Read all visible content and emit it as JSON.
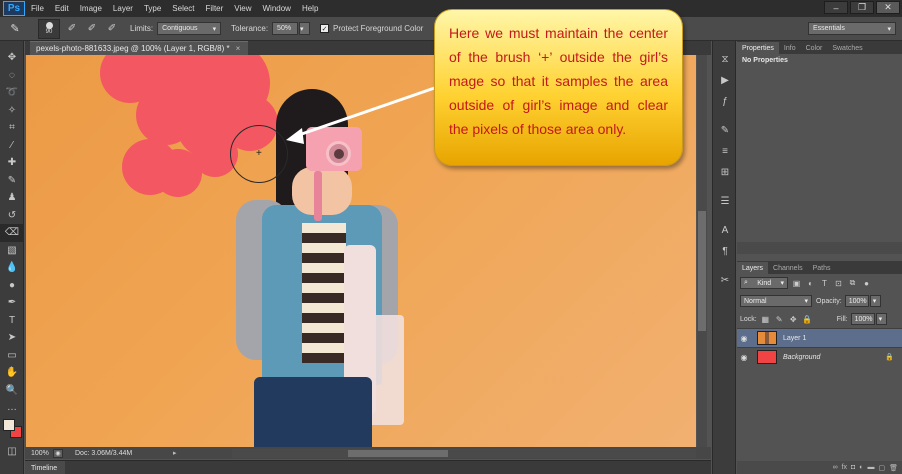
{
  "app": {
    "logo": "Ps"
  },
  "menu": [
    "File",
    "Edit",
    "Image",
    "Layer",
    "Type",
    "Select",
    "Filter",
    "View",
    "Window",
    "Help"
  ],
  "window_controls": {
    "minimize": "–",
    "restore": "❐",
    "close": "✕"
  },
  "options_bar": {
    "brush_size": "90",
    "limits_label": "Limits:",
    "limits_value": "Contiguous",
    "tolerance_label": "Tolerance:",
    "tolerance_value": "50%",
    "protect_label": "Protect Foreground Color",
    "protect_checked": "✓",
    "workspace": "Essentials"
  },
  "document": {
    "tab_title": "pexels-photo-881633.jpeg @ 100% (Layer 1, RGB/8) *",
    "tab_close": "×",
    "zoom": "100%",
    "doc_size": "Doc: 3.06M/3.44M",
    "status_arrow": "▸"
  },
  "timeline": {
    "tab": "Timeline"
  },
  "callout": {
    "text": "Here we must maintain the center of the brush ‘+’ outside the girl’s mage so that it samples the area outside of girl’s image and clear the pixels of those area only."
  },
  "brush_cursor": {
    "cross": "+"
  },
  "properties_panel": {
    "tabs": [
      "Properties",
      "Info",
      "Color",
      "Swatches"
    ],
    "body": "No Properties"
  },
  "layers_panel": {
    "tabs": [
      "Layers",
      "Channels",
      "Paths"
    ],
    "kind_label": "Kind",
    "blend_mode": "Normal",
    "opacity_label": "Opacity:",
    "opacity_value": "100%",
    "lock_label": "Lock:",
    "fill_label": "Fill:",
    "fill_value": "100%",
    "layers": [
      {
        "name": "Layer 1",
        "selected": true
      },
      {
        "name": "Background",
        "selected": false
      }
    ]
  },
  "colors": {
    "foreground": "#f2e6d9",
    "background": "#f04444",
    "erased_area": "#f35762",
    "callout_text": "#c4181d"
  }
}
